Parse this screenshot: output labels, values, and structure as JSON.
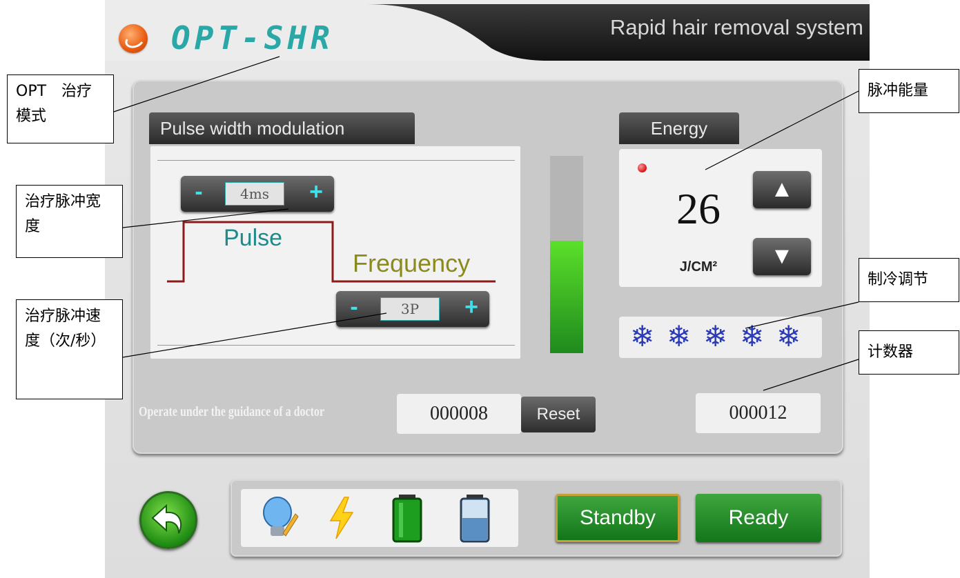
{
  "header": {
    "brand": "OPT-SHR",
    "subtitle": "Rapid hair removal system"
  },
  "pulse_panel": {
    "tab_label": "Pulse width modulation",
    "width_stepper": {
      "minus": "-",
      "value": "4ms",
      "plus": "+"
    },
    "pulse_label": "Pulse",
    "frequency_label": "Frequency",
    "freq_stepper": {
      "minus": "-",
      "value": "3P",
      "plus": "+"
    }
  },
  "energy_level_fraction": 0.57,
  "energy": {
    "tab_label": "Energy",
    "value": "26",
    "unit": "J/CM²",
    "up_icon": "▲",
    "down_icon": "▼"
  },
  "cooling": {
    "flake_icon": "❄",
    "level": 5
  },
  "counters": {
    "guidance_text": "Operate under the guidance of a doctor",
    "counter1": "000008",
    "reset_label": "Reset",
    "counter2": "000012"
  },
  "bottom": {
    "standby_label": "Standby",
    "ready_label": "Ready"
  },
  "annotations": {
    "opt_mode": "OPT　治疗模式",
    "pulse_width": "治疗脉冲宽度",
    "pulse_speed": "治疗脉冲速度（次/秒）",
    "pulse_energy": "脉冲能量",
    "cooling": "制冷调节",
    "counter": "计数器"
  },
  "colors": {
    "brand": "#2aa7a7",
    "pulse_text": "#1f8a8a",
    "frequency_text": "#8b8a1d",
    "wave_line": "#8b1a1a",
    "green": "#1f8a1e"
  }
}
